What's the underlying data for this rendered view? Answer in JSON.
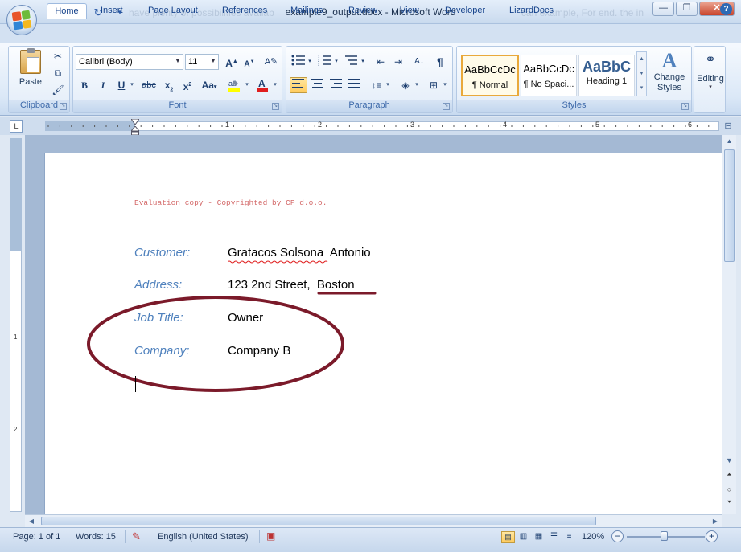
{
  "window": {
    "title": "example9_output.docx - Microsoft Word",
    "ghost_text": "have plenty of possibilities available to help in the end. For example, we can"
  },
  "tabs": [
    "Home",
    "Insert",
    "Page Layout",
    "References",
    "Mailings",
    "Review",
    "View",
    "Developer",
    "LizardDocs"
  ],
  "ribbon": {
    "clipboard": {
      "paste_label": "Paste",
      "group_label": "Clipboard"
    },
    "font": {
      "font_name": "Calibri (Body)",
      "font_size": "11",
      "group_label": "Font",
      "case_label": "Aa"
    },
    "paragraph": {
      "group_label": "Paragraph"
    },
    "styles": {
      "group_label": "Styles",
      "items": [
        {
          "sample": "AaBbCcDc",
          "name": "¶ Normal"
        },
        {
          "sample": "AaBbCcDc",
          "name": "¶ No Spaci..."
        },
        {
          "sample": "AaBbC",
          "name": "Heading 1"
        }
      ],
      "change_styles_label": "Change Styles"
    },
    "editing": {
      "label": "Editing"
    }
  },
  "ruler": {
    "numbers": [
      "1",
      "2",
      "3",
      "4",
      "5",
      "6"
    ]
  },
  "document": {
    "watermark": "Evaluation copy - Copyrighted by CP d.o.o.",
    "fields": [
      {
        "label": "Customer:",
        "value": "Gratacos Solsona  Antonio"
      },
      {
        "label": "Address:",
        "value": "123 2nd Street,  Boston"
      },
      {
        "label": "Job Title:",
        "value": "Owner"
      },
      {
        "label": "Company:",
        "value": "Company B"
      }
    ]
  },
  "status": {
    "page": "Page: 1 of 1",
    "words": "Words: 15",
    "language": "English (United States)",
    "zoom": "120%"
  },
  "colors": {
    "field_label": "#4f81bd",
    "annotation": "#7b1a2a",
    "watermark": "#d46a6a"
  }
}
